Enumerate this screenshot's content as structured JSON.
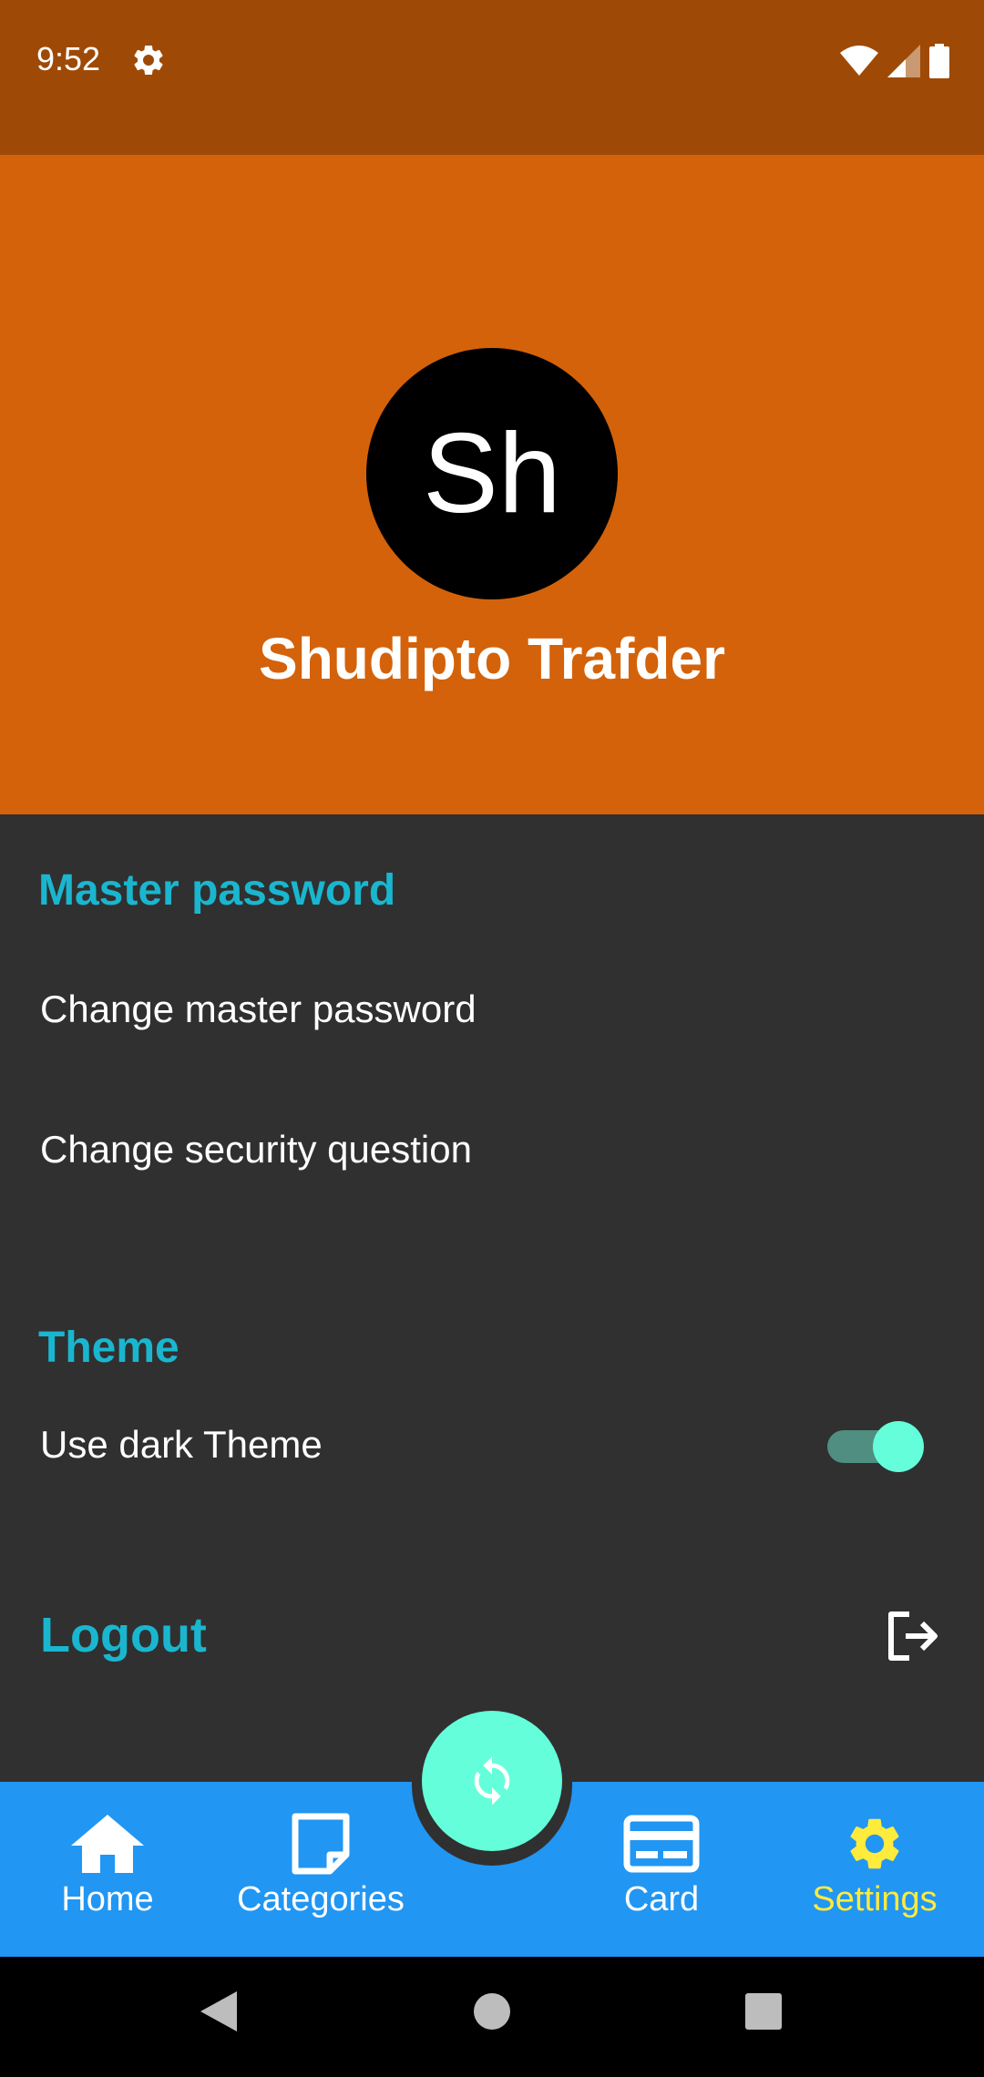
{
  "status_bar": {
    "time": "9:52"
  },
  "profile": {
    "avatar_initials": "Sh",
    "name": "Shudipto Trafder"
  },
  "settings": {
    "master_password_section": "Master password",
    "change_master_password": "Change master password",
    "change_security_question": "Change security question",
    "theme_section": "Theme",
    "dark_theme_label": "Use dark Theme",
    "dark_theme_enabled": true,
    "logout_label": "Logout"
  },
  "bottom_nav": {
    "items": [
      {
        "label": "Home",
        "icon": "home-icon",
        "active": false
      },
      {
        "label": "Categories",
        "icon": "note-icon",
        "active": false
      },
      {
        "label": "Card",
        "icon": "credit-card-icon",
        "active": false
      },
      {
        "label": "Settings",
        "icon": "gear-icon",
        "active": true
      }
    ],
    "fab_icon": "sync-icon"
  },
  "colors": {
    "status_bar": "#9e4a06",
    "header": "#d4620a",
    "background": "#303030",
    "accent_text": "#1ab6cf",
    "fab": "#64ffda",
    "bottom_nav": "#2196f3",
    "active_nav": "#ffeb3b"
  }
}
